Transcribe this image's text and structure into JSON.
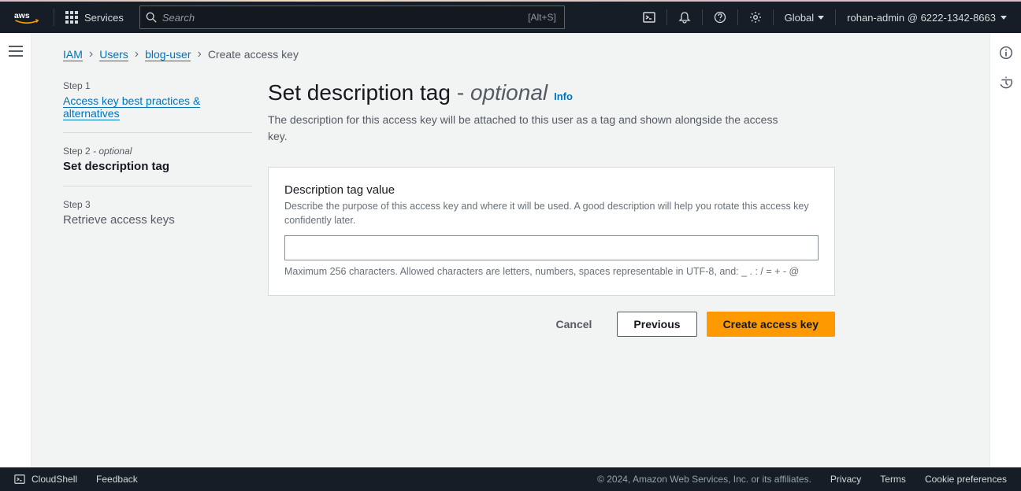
{
  "header": {
    "services_label": "Services",
    "search_placeholder": "Search",
    "search_shortcut": "[Alt+S]",
    "region": "Global",
    "user": "rohan-admin @ 6222-1342-8663"
  },
  "breadcrumb": {
    "iam": "IAM",
    "users": "Users",
    "username": "blog-user",
    "current": "Create access key"
  },
  "steps": {
    "s1_label": "Step 1",
    "s1_title": "Access key best practices & alternatives",
    "s2_label": "Step 2",
    "s2_optional": " - optional",
    "s2_title": "Set description tag",
    "s3_label": "Step 3",
    "s3_title": "Retrieve access keys"
  },
  "main": {
    "title": "Set description tag",
    "title_dash": " - ",
    "title_optional": "optional",
    "info": "Info",
    "desc": "The description for this access key will be attached to this user as a tag and shown alongside the access key.",
    "field_label": "Description tag value",
    "field_desc": "Describe the purpose of this access key and where it will be used. A good description will help you rotate this access key confidently later.",
    "field_value": "",
    "field_hint": "Maximum 256 characters. Allowed characters are letters, numbers, spaces representable in UTF-8, and: _ . : / = + - @"
  },
  "actions": {
    "cancel": "Cancel",
    "previous": "Previous",
    "create": "Create access key"
  },
  "footer": {
    "cloudshell": "CloudShell",
    "feedback": "Feedback",
    "copyright": "© 2024, Amazon Web Services, Inc. or its affiliates.",
    "privacy": "Privacy",
    "terms": "Terms",
    "cookies": "Cookie preferences"
  }
}
